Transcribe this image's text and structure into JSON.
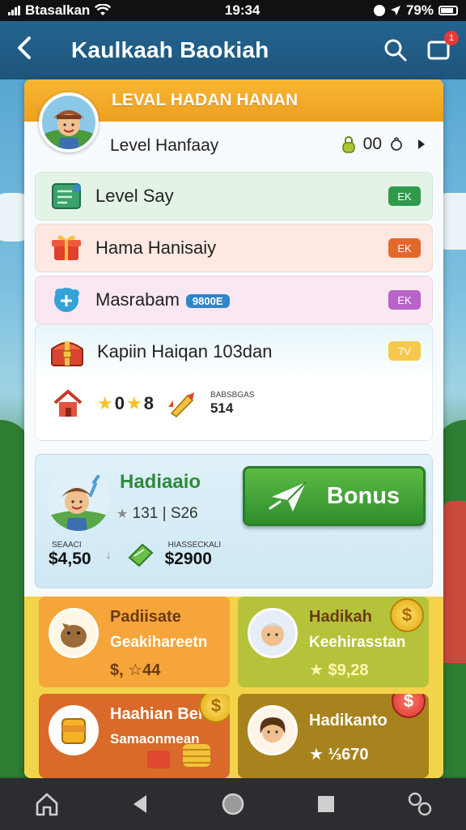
{
  "status_bar": {
    "carrier": "Btasalkan",
    "time": "19:34",
    "battery": "79%"
  },
  "header": {
    "title": "Kaulkaah Baokiah",
    "notification_count": "1"
  },
  "level_card": {
    "banner": "LEVAL HADAN HANAN",
    "name": "Level Hanfaay",
    "stat": "00"
  },
  "list_items": [
    {
      "label": "Level Say",
      "pill": "EK",
      "color": "#2f9a4a",
      "bg": "#e3f4e6"
    },
    {
      "label": "Hama Hanisaiy",
      "pill": "EK",
      "color": "#e2682c",
      "bg": "#fde9e2"
    },
    {
      "label": "Masrabam",
      "tag": "9800E",
      "pill": "EK",
      "color": "#b863c9",
      "bg": "#f9e7f1"
    }
  ],
  "quest": {
    "title": "Kapiin Haiqan 103dan",
    "pill": "7V",
    "stars": "0",
    "stars2": "8",
    "reward_caption": "BABSBGAS",
    "reward_value": "514"
  },
  "bonus": {
    "name": "Hadiaaio",
    "stat": "131 | S26",
    "button_label": "Bonus",
    "left_caption": "SEAACI",
    "left_value": "$4,50",
    "right_caption": "HIASSECKALI",
    "right_value": "$2900"
  },
  "reward_cards": [
    {
      "title": "Padiisate",
      "subtitle": "Geakihareetn",
      "value": "$, ☆44",
      "bg": "#f6a53a"
    },
    {
      "title": "Hadikah",
      "subtitle": "Keehirasstan",
      "value": "★ $9,28",
      "bg": "#b5c33b"
    },
    {
      "title": "Haahian Bel",
      "subtitle": "Samaonmean",
      "value": "",
      "bg": "#d96a2a"
    },
    {
      "title": "Hadikanto",
      "subtitle": "",
      "value": "★ ⅓670",
      "bg": "#a8831d"
    }
  ]
}
